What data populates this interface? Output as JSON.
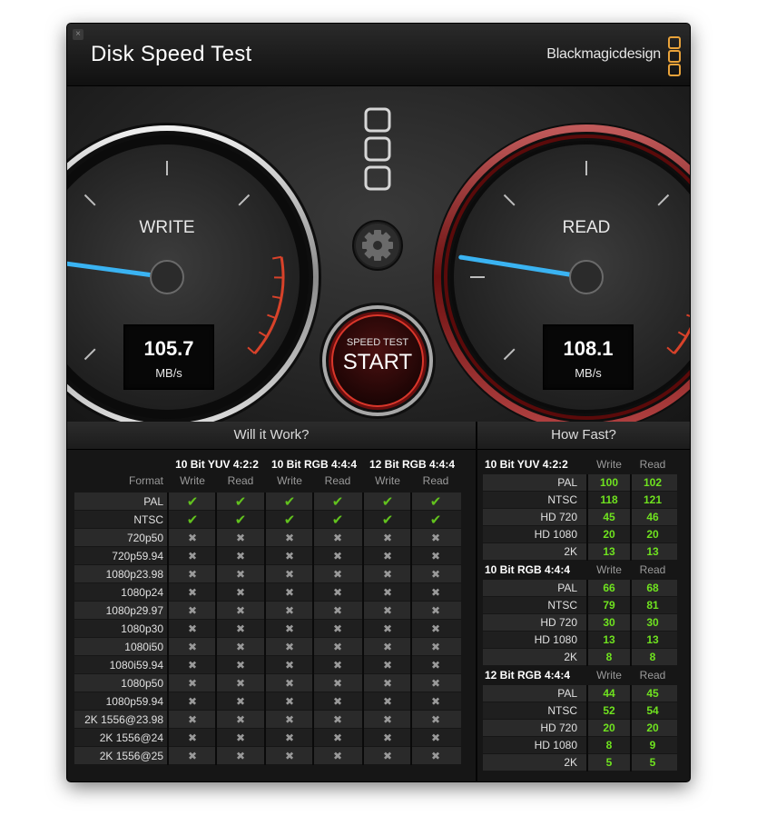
{
  "app": {
    "title": "Disk Speed Test",
    "brand": "Blackmagicdesign",
    "close_glyph": "×"
  },
  "gauges": {
    "write": {
      "label": "WRITE",
      "value": "105.7",
      "unit": "MB/s",
      "level": 0.42,
      "accent": "#3ab3f2"
    },
    "read": {
      "label": "READ",
      "value": "108.1",
      "unit": "MB/s",
      "level": 0.43,
      "accent": "#3ab3f2"
    }
  },
  "start": {
    "caption": "SPEED TEST",
    "label": "START"
  },
  "icons": {
    "settings": "gear-icon",
    "logo": "blackmagic-logo-icon"
  },
  "will_it_work": {
    "title": "Will it Work?",
    "format_label": "Format",
    "groups": [
      "10 Bit YUV 4:2:2",
      "10 Bit RGB 4:4:4",
      "12 Bit RGB 4:4:4"
    ],
    "cols": [
      "Write",
      "Read",
      "Write",
      "Read",
      "Write",
      "Read"
    ],
    "ok_glyph": "✔",
    "no_glyph": "✖",
    "rows": [
      {
        "format": "PAL",
        "marks": [
          true,
          true,
          true,
          true,
          true,
          true
        ]
      },
      {
        "format": "NTSC",
        "marks": [
          true,
          true,
          true,
          true,
          true,
          true
        ]
      },
      {
        "format": "720p50",
        "marks": [
          false,
          false,
          false,
          false,
          false,
          false
        ]
      },
      {
        "format": "720p59.94",
        "marks": [
          false,
          false,
          false,
          false,
          false,
          false
        ]
      },
      {
        "format": "1080p23.98",
        "marks": [
          false,
          false,
          false,
          false,
          false,
          false
        ]
      },
      {
        "format": "1080p24",
        "marks": [
          false,
          false,
          false,
          false,
          false,
          false
        ]
      },
      {
        "format": "1080p29.97",
        "marks": [
          false,
          false,
          false,
          false,
          false,
          false
        ]
      },
      {
        "format": "1080p30",
        "marks": [
          false,
          false,
          false,
          false,
          false,
          false
        ]
      },
      {
        "format": "1080i50",
        "marks": [
          false,
          false,
          false,
          false,
          false,
          false
        ]
      },
      {
        "format": "1080i59.94",
        "marks": [
          false,
          false,
          false,
          false,
          false,
          false
        ]
      },
      {
        "format": "1080p50",
        "marks": [
          false,
          false,
          false,
          false,
          false,
          false
        ]
      },
      {
        "format": "1080p59.94",
        "marks": [
          false,
          false,
          false,
          false,
          false,
          false
        ]
      },
      {
        "format": "2K 1556@23.98",
        "marks": [
          false,
          false,
          false,
          false,
          false,
          false
        ]
      },
      {
        "format": "2K 1556@24",
        "marks": [
          false,
          false,
          false,
          false,
          false,
          false
        ]
      },
      {
        "format": "2K 1556@25",
        "marks": [
          false,
          false,
          false,
          false,
          false,
          false
        ]
      }
    ]
  },
  "how_fast": {
    "title": "How Fast?",
    "groups": [
      {
        "name": "10 Bit YUV 4:2:2",
        "write": "Write",
        "read": "Read",
        "rows": [
          {
            "format": "PAL",
            "write": "100",
            "read": "102"
          },
          {
            "format": "NTSC",
            "write": "118",
            "read": "121"
          },
          {
            "format": "HD 720",
            "write": "45",
            "read": "46"
          },
          {
            "format": "HD 1080",
            "write": "20",
            "read": "20"
          },
          {
            "format": "2K",
            "write": "13",
            "read": "13"
          }
        ]
      },
      {
        "name": "10 Bit RGB 4:4:4",
        "write": "Write",
        "read": "Read",
        "rows": [
          {
            "format": "PAL",
            "write": "66",
            "read": "68"
          },
          {
            "format": "NTSC",
            "write": "79",
            "read": "81"
          },
          {
            "format": "HD 720",
            "write": "30",
            "read": "30"
          },
          {
            "format": "HD 1080",
            "write": "13",
            "read": "13"
          },
          {
            "format": "2K",
            "write": "8",
            "read": "8"
          }
        ]
      },
      {
        "name": "12 Bit RGB 4:4:4",
        "write": "Write",
        "read": "Read",
        "rows": [
          {
            "format": "PAL",
            "write": "44",
            "read": "45"
          },
          {
            "format": "NTSC",
            "write": "52",
            "read": "54"
          },
          {
            "format": "HD 720",
            "write": "20",
            "read": "20"
          },
          {
            "format": "HD 1080",
            "write": "8",
            "read": "9"
          },
          {
            "format": "2K",
            "write": "5",
            "read": "5"
          }
        ]
      }
    ]
  }
}
